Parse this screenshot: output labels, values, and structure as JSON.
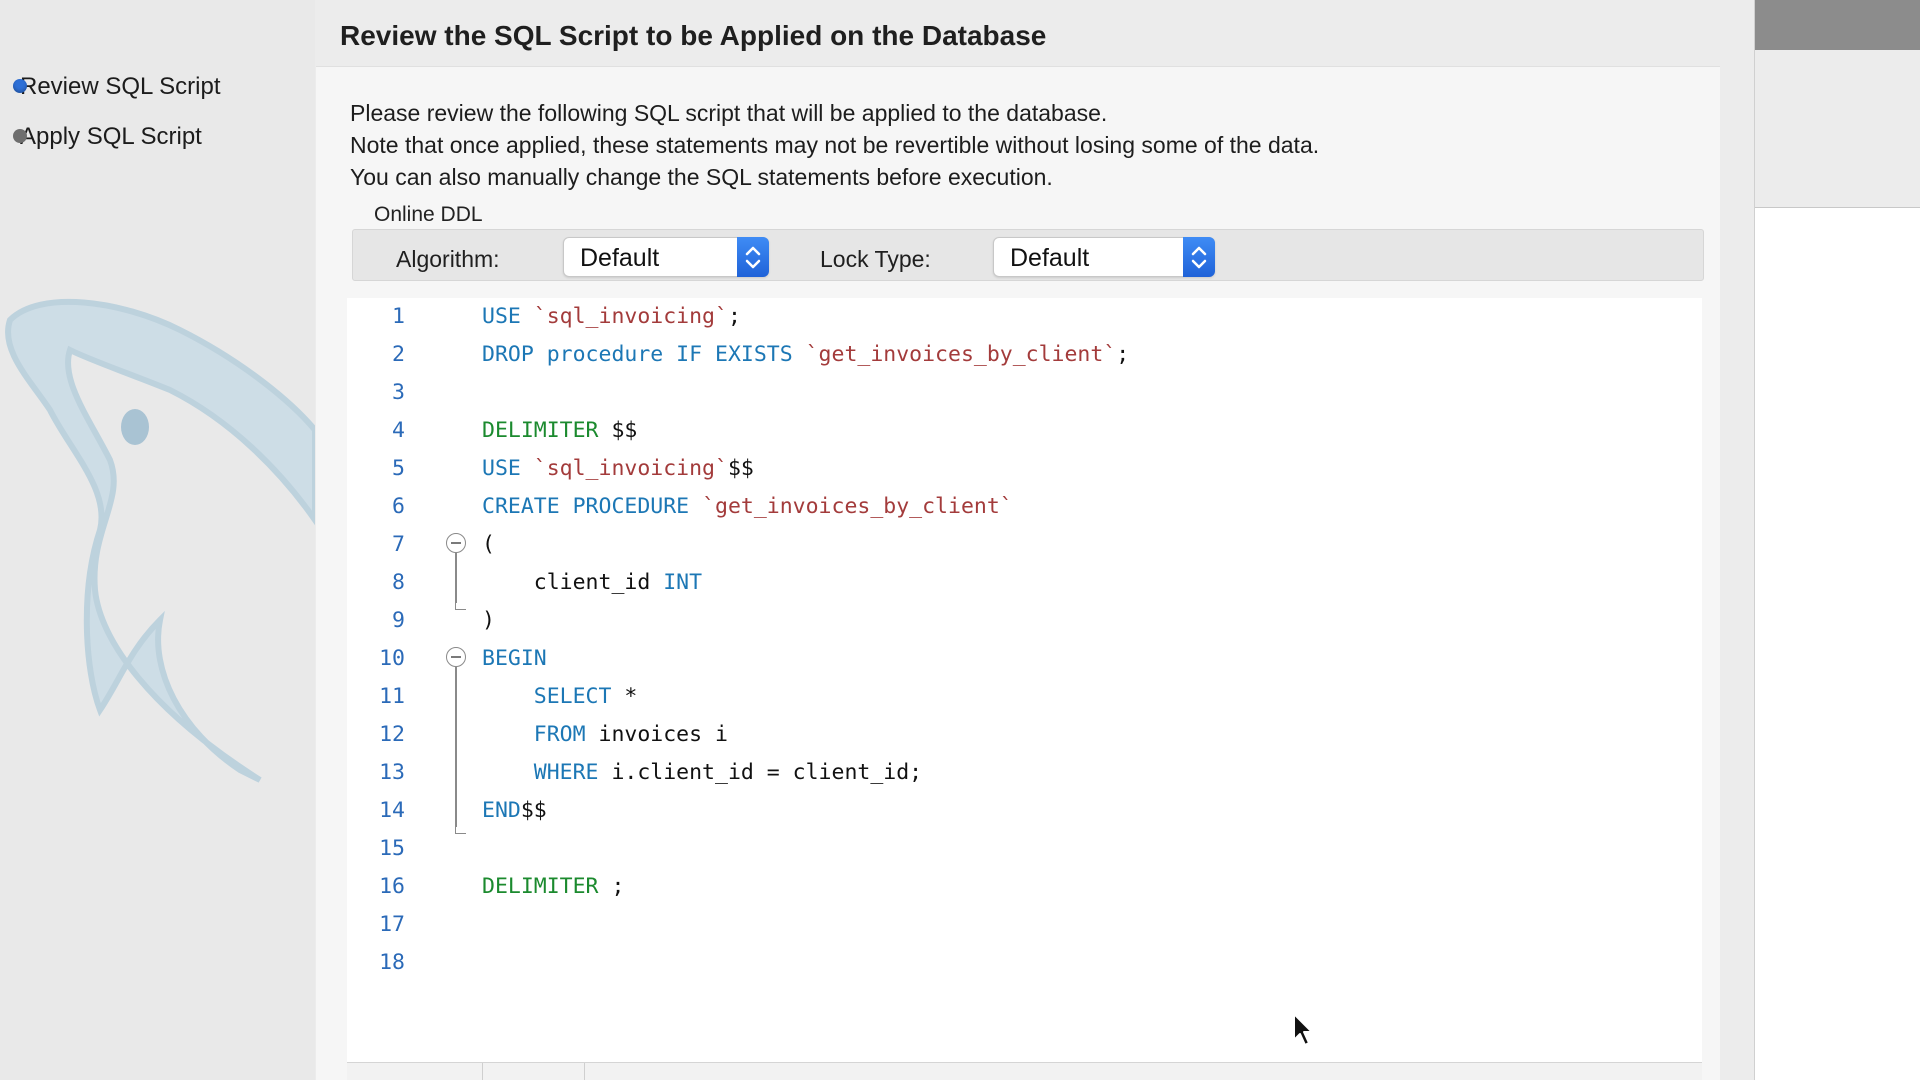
{
  "window": {
    "title": "Review the SQL Script to be Applied on the Database"
  },
  "sidebar": {
    "steps": [
      {
        "label": "Review SQL Script",
        "active": true
      },
      {
        "label": "Apply SQL Script",
        "active": false
      }
    ]
  },
  "description": [
    "Please review the following SQL script that will be applied to the database.",
    "Note that once applied, these statements may not be revertible without losing some of the data.",
    "You can also manually change the SQL statements before execution."
  ],
  "online_ddl": {
    "group_label": "Online DDL",
    "algorithm_label": "Algorithm:",
    "algorithm_value": "Default",
    "lock_type_label": "Lock Type:",
    "lock_type_value": "Default"
  },
  "editor": {
    "lines": [
      {
        "num": "1",
        "tokens": [
          {
            "t": "USE ",
            "c": "kw"
          },
          {
            "t": "`sql_invoicing`",
            "c": "str"
          },
          {
            "t": ";",
            "c": "plain"
          }
        ]
      },
      {
        "num": "2",
        "tokens": [
          {
            "t": "DROP procedure IF EXISTS ",
            "c": "kw"
          },
          {
            "t": "`get_invoices_by_client`",
            "c": "str"
          },
          {
            "t": ";",
            "c": "plain"
          }
        ]
      },
      {
        "num": "3",
        "tokens": []
      },
      {
        "num": "4",
        "tokens": [
          {
            "t": "DELIMITER ",
            "c": "kw2"
          },
          {
            "t": "$$",
            "c": "plain"
          }
        ]
      },
      {
        "num": "5",
        "tokens": [
          {
            "t": "USE ",
            "c": "kw"
          },
          {
            "t": "`sql_invoicing`",
            "c": "str"
          },
          {
            "t": "$$",
            "c": "plain"
          }
        ]
      },
      {
        "num": "6",
        "tokens": [
          {
            "t": "CREATE PROCEDURE ",
            "c": "kw"
          },
          {
            "t": "`get_invoices_by_client`",
            "c": "str"
          }
        ]
      },
      {
        "num": "7",
        "tokens": [
          {
            "t": "(",
            "c": "plain"
          }
        ]
      },
      {
        "num": "8",
        "tokens": [
          {
            "t": "    client_id ",
            "c": "plain"
          },
          {
            "t": "INT",
            "c": "kw"
          }
        ]
      },
      {
        "num": "9",
        "tokens": [
          {
            "t": ")",
            "c": "plain"
          }
        ]
      },
      {
        "num": "10",
        "tokens": [
          {
            "t": "BEGIN",
            "c": "kw"
          }
        ]
      },
      {
        "num": "11",
        "tokens": [
          {
            "t": "    ",
            "c": "plain"
          },
          {
            "t": "SELECT ",
            "c": "kw"
          },
          {
            "t": "*",
            "c": "plain"
          }
        ]
      },
      {
        "num": "12",
        "tokens": [
          {
            "t": "    ",
            "c": "plain"
          },
          {
            "t": "FROM ",
            "c": "kw"
          },
          {
            "t": "invoices i",
            "c": "plain"
          }
        ]
      },
      {
        "num": "13",
        "tokens": [
          {
            "t": "    ",
            "c": "plain"
          },
          {
            "t": "WHERE ",
            "c": "kw"
          },
          {
            "t": "i.client_id = client_id;",
            "c": "plain"
          }
        ]
      },
      {
        "num": "14",
        "tokens": [
          {
            "t": "END",
            "c": "kw"
          },
          {
            "t": "$$",
            "c": "plain"
          }
        ]
      },
      {
        "num": "15",
        "tokens": []
      },
      {
        "num": "16",
        "tokens": [
          {
            "t": "DELIMITER ",
            "c": "kw2"
          },
          {
            "t": ";",
            "c": "plain"
          }
        ]
      },
      {
        "num": "17",
        "tokens": []
      },
      {
        "num": "18",
        "tokens": []
      }
    ]
  },
  "colors": {
    "accent": "#2d6fd6",
    "keyword": "#1c77b5",
    "delimiter_keyword": "#1b8a2e",
    "string": "#a33b3b",
    "line_number": "#2b6ab8"
  },
  "icons": {
    "select_arrows": "chevron-up-down-icon",
    "fold": "fold-collapse-icon",
    "logo": "mysql-dolphin-icon",
    "cursor": "mouse-pointer-icon"
  }
}
